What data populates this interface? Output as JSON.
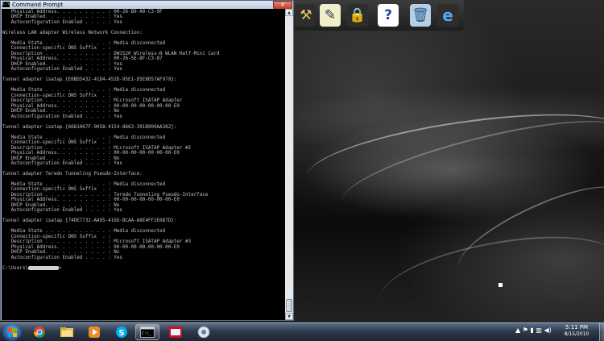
{
  "window": {
    "title": "Command Prompt",
    "icon_text": "C:\\",
    "close_label": "✕"
  },
  "console_lines": [
    "   Physical Address. . . . . . . . . : 00-26-B9-A0-C3-9F",
    "   DHCP Enabled. . . . . . . . . . . : Yes",
    "   Autoconfiguration Enabled . . . . : Yes",
    "",
    "Wireless LAN adapter Wireless Network Connection:",
    "",
    "   Media State . . . . . . . . . . . : Media disconnected",
    "   Connection-specific DNS Suffix  . :",
    "   Description . . . . . . . . . . . : DW1520 Wireless-N WLAN Half-Mini Card",
    "   Physical Address. . . . . . . . . : 00-26-5E-8F-C3-87",
    "   DHCP Enabled. . . . . . . . . . . : Yes",
    "   Autoconfiguration Enabled . . . . : Yes",
    "",
    "Tunnel adapter isatap.{E6BD5432-41D4-452D-95E1-D5E8D57AF979}:",
    "",
    "   Media State . . . . . . . . . . . : Media disconnected",
    "   Connection-specific DNS Suffix  . :",
    "   Description . . . . . . . . . . . : Microsoft ISATAP Adapter",
    "   Physical Address. . . . . . . . . : 00-00-00-00-00-00-00-E0",
    "   DHCP Enabled. . . . . . . . . . . : No",
    "   Autoconfiguration Enabled . . . . : Yes",
    "",
    "Tunnel adapter isatap.{6681067F-9058-4154-8663-391B900AA382}:",
    "",
    "   Media State . . . . . . . . . . . : Media disconnected",
    "   Connection-specific DNS Suffix  . :",
    "   Description . . . . . . . . . . . : Microsoft ISATAP Adapter #2",
    "   Physical Address. . . . . . . . . : 00-00-00-00-00-00-00-E0",
    "   DHCP Enabled. . . . . . . . . . . : No",
    "   Autoconfiguration Enabled . . . . : Yes",
    "",
    "Tunnel adapter Teredo Tunneling Pseudo-Interface:",
    "",
    "   Media State . . . . . . . . . . . : Media disconnected",
    "   Connection-specific DNS Suffix  . :",
    "   Description . . . . . . . . . . . : Teredo Tunneling Pseudo-Interface",
    "   Physical Address. . . . . . . . . : 00-00-00-00-00-00-00-E0",
    "   DHCP Enabled. . . . . . . . . . . : No",
    "   Autoconfiguration Enabled . . . . : Yes",
    "",
    "Tunnel adapter isatap.{74DE7732-AA95-416D-BCAA-A6E4FF2E6B7D}:",
    "",
    "   Media State . . . . . . . . . . . : Media disconnected",
    "   Connection-specific DNS Suffix  . :",
    "   Description . . . . . . . . . . . : Microsoft ISATAP Adapter #3",
    "   Physical Address. . . . . . . . . : 00-00-00-00-00-00-00-E0",
    "   DHCP Enabled. . . . . . . . . . . : No",
    "   Autoconfiguration Enabled . . . . : Yes",
    ""
  ],
  "prompt_prefix": "C:\\Users\\",
  "prompt_suffix": ">",
  "dock_icons": [
    "tools-icon",
    "notes-icon",
    "lock-icon",
    "help-icon",
    "recycle-bin-icon",
    "internet-explorer-icon"
  ],
  "taskbar": {
    "buttons": [
      "chrome-icon",
      "explorer-icon",
      "media-player-icon",
      "skype-icon",
      "command-prompt-icon",
      "acrobat-icon",
      "control-panel-icon"
    ],
    "active_button": "command-prompt-icon",
    "clock_time": "5:11 PM",
    "clock_date": "8/15/2010"
  },
  "colors": {
    "console_bg": "#000000",
    "console_text": "#c0c0c0",
    "close_red": "#c2391f"
  }
}
